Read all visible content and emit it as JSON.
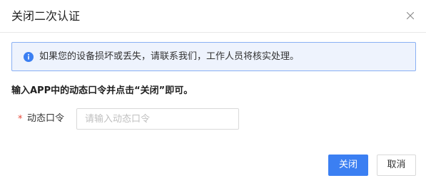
{
  "dialog": {
    "title": "关闭二次认证",
    "close_icon": "close-icon"
  },
  "alert": {
    "icon": "info-icon",
    "text": "如果您的设备损坏或丢失，请联系我们，工作人员将核实处理。",
    "accent_color": "#3b7ff2"
  },
  "instruction": "输入APP中的动态口令并点击“关闭”即可。",
  "form": {
    "required_mark": "*",
    "label": "动态口令",
    "input_value": "",
    "placeholder": "请输入动态口令"
  },
  "footer": {
    "confirm_label": "关闭",
    "cancel_label": "取消"
  },
  "colors": {
    "primary": "#3b7ff2",
    "required": "#e64a3b",
    "alert_bg": "#eef3fd",
    "alert_border": "#8ab0f4"
  }
}
